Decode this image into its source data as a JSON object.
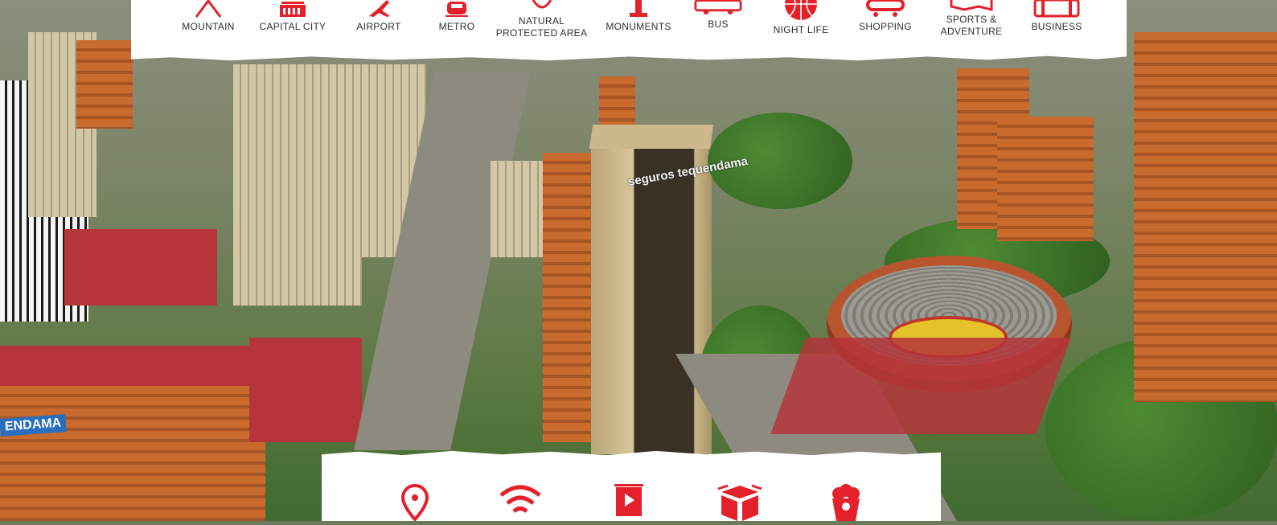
{
  "brand": {
    "accent_color": "#e4202a",
    "label_color": "#2f2f2f",
    "bar_color": "#ffffff"
  },
  "categories": [
    {
      "label_line1": "MOUNTAIN",
      "label_line2": "",
      "icon": "mountain-icon"
    },
    {
      "label_line1": "CAPITAL CITY",
      "label_line2": "",
      "icon": "capitol-building-icon"
    },
    {
      "label_line1": "AIRPORT",
      "label_line2": "",
      "icon": "airplane-icon"
    },
    {
      "label_line1": "METRO",
      "label_line2": "",
      "icon": "metro-train-icon"
    },
    {
      "label_line1": "NATURAL",
      "label_line2": "PROTECTED AREA",
      "icon": "leaf-icon"
    },
    {
      "label_line1": "MONUMENTS",
      "label_line2": "",
      "icon": "monument-icon"
    },
    {
      "label_line1": "BUS",
      "label_line2": "",
      "icon": "bus-icon"
    },
    {
      "label_line1": "NIGHT LIFE",
      "label_line2": "",
      "icon": "disco-ball-icon"
    },
    {
      "label_line1": "SHOPPING",
      "label_line2": "",
      "icon": "shopping-cart-icon"
    },
    {
      "label_line1": "SPORTS &",
      "label_line2": "ADVENTURE",
      "icon": "map-icon"
    },
    {
      "label_line1": "BUSINESS",
      "label_line2": "",
      "icon": "briefcase-icon"
    }
  ],
  "amenities": [
    {
      "icon": "location-pin-icon"
    },
    {
      "icon": "wifi-icon"
    },
    {
      "icon": "presentation-board-icon"
    },
    {
      "icon": "open-box-icon"
    },
    {
      "icon": "popcorn-icon"
    }
  ],
  "photo_signage": {
    "tower_sign": "seguros tequendama",
    "building_sign": "ENDAMA"
  }
}
